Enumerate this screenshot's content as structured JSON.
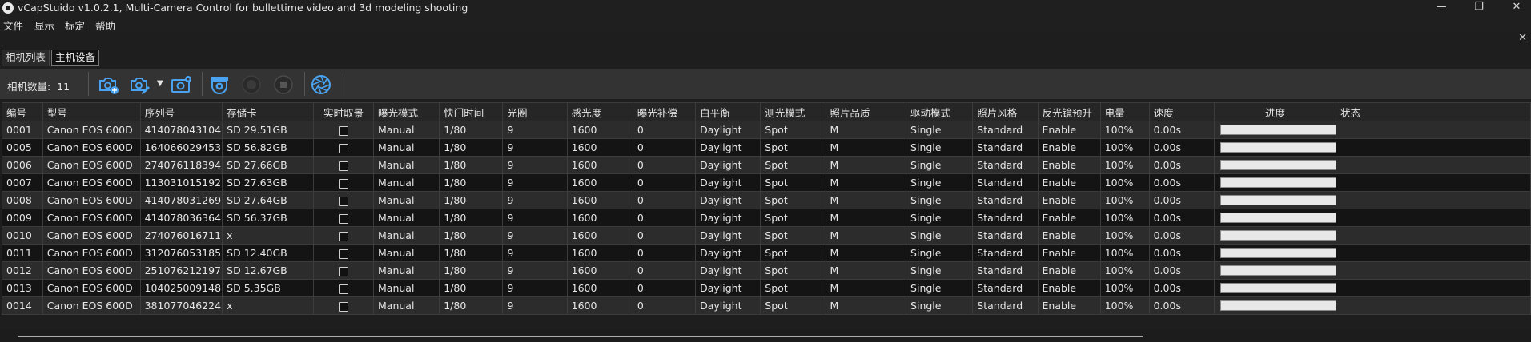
{
  "window": {
    "title": "vCapStuido v1.0.2.1, Multi-Camera Control for bullettime video and 3d modeling shooting",
    "minimize_icon": "—",
    "restore_icon": "❐",
    "close_icon": "✕",
    "mdi_close_icon": "✕"
  },
  "menu": [
    "文件",
    "显示",
    "标定",
    "帮助"
  ],
  "tabs": [
    "相机列表",
    "主机设备"
  ],
  "toolbar": {
    "count_label": "相机数量:",
    "count_value": "11",
    "icons": [
      "add-camera-icon",
      "edit-camera-icon",
      "camera-settings-icon",
      "dome-camera-icon",
      "record-start-icon",
      "record-stop-icon",
      "aperture-icon"
    ],
    "dropdown_arrow": "▼"
  },
  "table": {
    "columns": [
      "编号",
      "型号",
      "序列号",
      "存储卡",
      "实时取景",
      "曝光模式",
      "快门时间",
      "光圈",
      "感光度",
      "曝光补偿",
      "白平衡",
      "测光模式",
      "照片品质",
      "驱动模式",
      "照片风格",
      "反光镜预升",
      "电量",
      "速度",
      "进度",
      "状态"
    ],
    "rows": [
      {
        "id": "0001",
        "model": "Canon EOS 600D",
        "serial": "414078043104",
        "card": "SD 29.51GB",
        "liveview": false,
        "exposure": "Manual",
        "shutter": "1/80",
        "aperture": "9",
        "iso": "1600",
        "ev": "0",
        "wb": "Daylight",
        "metering": "Spot",
        "quality": "M",
        "drive": "Single",
        "style": "Standard",
        "mirror": "Enable",
        "battery": "100%",
        "speed": "0.00s",
        "progress": 100,
        "status": ""
      },
      {
        "id": "0005",
        "model": "Canon EOS 600D",
        "serial": "164066029453",
        "card": "SD 56.82GB",
        "liveview": false,
        "exposure": "Manual",
        "shutter": "1/80",
        "aperture": "9",
        "iso": "1600",
        "ev": "0",
        "wb": "Daylight",
        "metering": "Spot",
        "quality": "M",
        "drive": "Single",
        "style": "Standard",
        "mirror": "Enable",
        "battery": "100%",
        "speed": "0.00s",
        "progress": 100,
        "status": ""
      },
      {
        "id": "0006",
        "model": "Canon EOS 600D",
        "serial": "274076118394",
        "card": "SD 27.66GB",
        "liveview": false,
        "exposure": "Manual",
        "shutter": "1/80",
        "aperture": "9",
        "iso": "1600",
        "ev": "0",
        "wb": "Daylight",
        "metering": "Spot",
        "quality": "M",
        "drive": "Single",
        "style": "Standard",
        "mirror": "Enable",
        "battery": "100%",
        "speed": "0.00s",
        "progress": 100,
        "status": ""
      },
      {
        "id": "0007",
        "model": "Canon EOS 600D",
        "serial": "113031015192",
        "card": "SD 27.63GB",
        "liveview": false,
        "exposure": "Manual",
        "shutter": "1/80",
        "aperture": "9",
        "iso": "1600",
        "ev": "0",
        "wb": "Daylight",
        "metering": "Spot",
        "quality": "M",
        "drive": "Single",
        "style": "Standard",
        "mirror": "Enable",
        "battery": "100%",
        "speed": "0.00s",
        "progress": 100,
        "status": ""
      },
      {
        "id": "0008",
        "model": "Canon EOS 600D",
        "serial": "414078031269",
        "card": "SD 27.64GB",
        "liveview": false,
        "exposure": "Manual",
        "shutter": "1/80",
        "aperture": "9",
        "iso": "1600",
        "ev": "0",
        "wb": "Daylight",
        "metering": "Spot",
        "quality": "M",
        "drive": "Single",
        "style": "Standard",
        "mirror": "Enable",
        "battery": "100%",
        "speed": "0.00s",
        "progress": 100,
        "status": ""
      },
      {
        "id": "0009",
        "model": "Canon EOS 600D",
        "serial": "414078036364",
        "card": "SD 56.37GB",
        "liveview": false,
        "exposure": "Manual",
        "shutter": "1/80",
        "aperture": "9",
        "iso": "1600",
        "ev": "0",
        "wb": "Daylight",
        "metering": "Spot",
        "quality": "M",
        "drive": "Single",
        "style": "Standard",
        "mirror": "Enable",
        "battery": "100%",
        "speed": "0.00s",
        "progress": 100,
        "status": ""
      },
      {
        "id": "0010",
        "model": "Canon EOS 600D",
        "serial": "274076016711",
        "card": "x",
        "liveview": false,
        "exposure": "Manual",
        "shutter": "1/80",
        "aperture": "9",
        "iso": "1600",
        "ev": "0",
        "wb": "Daylight",
        "metering": "Spot",
        "quality": "M",
        "drive": "Single",
        "style": "Standard",
        "mirror": "Enable",
        "battery": "100%",
        "speed": "0.00s",
        "progress": 100,
        "status": ""
      },
      {
        "id": "0011",
        "model": "Canon EOS 600D",
        "serial": "312076053185",
        "card": "SD 12.40GB",
        "liveview": false,
        "exposure": "Manual",
        "shutter": "1/80",
        "aperture": "9",
        "iso": "1600",
        "ev": "0",
        "wb": "Daylight",
        "metering": "Spot",
        "quality": "M",
        "drive": "Single",
        "style": "Standard",
        "mirror": "Enable",
        "battery": "100%",
        "speed": "0.00s",
        "progress": 100,
        "status": ""
      },
      {
        "id": "0012",
        "model": "Canon EOS 600D",
        "serial": "251076212197",
        "card": "SD 12.67GB",
        "liveview": false,
        "exposure": "Manual",
        "shutter": "1/80",
        "aperture": "9",
        "iso": "1600",
        "ev": "0",
        "wb": "Daylight",
        "metering": "Spot",
        "quality": "M",
        "drive": "Single",
        "style": "Standard",
        "mirror": "Enable",
        "battery": "100%",
        "speed": "0.00s",
        "progress": 100,
        "status": ""
      },
      {
        "id": "0013",
        "model": "Canon EOS 600D",
        "serial": "104025009148",
        "card": "SD 5.35GB",
        "liveview": false,
        "exposure": "Manual",
        "shutter": "1/80",
        "aperture": "9",
        "iso": "1600",
        "ev": "0",
        "wb": "Daylight",
        "metering": "Spot",
        "quality": "M",
        "drive": "Single",
        "style": "Standard",
        "mirror": "Enable",
        "battery": "100%",
        "speed": "0.00s",
        "progress": 100,
        "status": ""
      },
      {
        "id": "0014",
        "model": "Canon EOS 600D",
        "serial": "381077046224",
        "card": "x",
        "liveview": false,
        "exposure": "Manual",
        "shutter": "1/80",
        "aperture": "9",
        "iso": "1600",
        "ev": "0",
        "wb": "Daylight",
        "metering": "Spot",
        "quality": "M",
        "drive": "Single",
        "style": "Standard",
        "mirror": "Enable",
        "battery": "100%",
        "speed": "0.00s",
        "progress": 100,
        "status": ""
      }
    ]
  },
  "colors": {
    "accent": "#4aa3f0",
    "background": "#1e1e1e",
    "row_alt": "#2c2c2c"
  }
}
